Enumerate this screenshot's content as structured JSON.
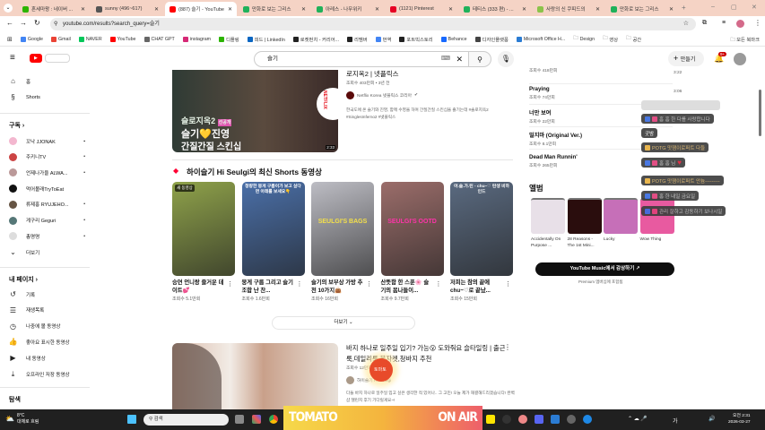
{
  "browser": {
    "tabs": [
      {
        "label": "혼세마왕 : 네이버 ...",
        "color": "#2db400"
      },
      {
        "label": "sunny (496~617)",
        "color": "#555"
      },
      {
        "label": "(887) 슬기 - YouTube",
        "color": "#ff0000",
        "active": true
      },
      {
        "label": "만화로 보는 그리스",
        "color": "#20b15a"
      },
      {
        "label": "아레스 - 나무위키",
        "color": "#20b15a"
      },
      {
        "label": "(1121) Pinterest",
        "color": "#e60023"
      },
      {
        "label": "테티스 (333 편) - ...",
        "color": "#20b15a"
      },
      {
        "label": "사랑의 신 쿠피드의",
        "color": "#8bc34a"
      },
      {
        "label": "만화로 보는 그리스",
        "color": "#20b15a"
      }
    ],
    "new_tab": "+",
    "window_controls": [
      "–",
      "▢",
      "✕"
    ],
    "url": "youtube.com/results?search_query=슬기",
    "bookmarks": [
      {
        "label": "Google",
        "color": "#4285f4"
      },
      {
        "label": "Gmail",
        "color": "#ea4335"
      },
      {
        "label": "NAVER",
        "color": "#03c75a"
      },
      {
        "label": "YouTube",
        "color": "#ff0000"
      },
      {
        "label": "CHAT GPT",
        "color": "#666"
      },
      {
        "label": "instagram",
        "color": "#d62976"
      },
      {
        "label": "디플링",
        "color": "#2db400"
      },
      {
        "label": "피드 | LinkedIn",
        "color": "#0a66c2"
      },
      {
        "label": "로켓펀치 - 커리어...",
        "color": "#222"
      },
      {
        "label": "리멤버",
        "color": "#222"
      },
      {
        "label": "번역",
        "color": "#4285f4"
      },
      {
        "label": "포트빅스토리",
        "color": "#222"
      },
      {
        "label": "Behance",
        "color": "#1769ff"
      },
      {
        "label": "디자인플랫폼",
        "color": "#444"
      },
      {
        "label": "Microsoft Office H...",
        "color": "#2b7cd3"
      },
      {
        "label": "Design",
        "color": "#fff"
      },
      {
        "label": "영상",
        "color": "#fff"
      },
      {
        "label": "공간",
        "color": "#fff"
      }
    ],
    "all_bookmarks": "모든 북마크"
  },
  "youtube": {
    "search_value": "슬기",
    "create_label": "만들기",
    "notif_count": "9+",
    "sidebar": {
      "top": [
        {
          "label": "홈",
          "icon": "home-icon"
        },
        {
          "label": "Shorts",
          "icon": "shorts-icon"
        }
      ],
      "subs_title": "구독",
      "subs": [
        {
          "label": "꼬낙 JJONAK",
          "color": "#f3b7cf"
        },
        {
          "label": "주키니TV",
          "color": "#c44"
        },
        {
          "label": "언제나가을 ALWA...",
          "color": "#b99"
        },
        {
          "label": "먹어볼래TryToEat",
          "color": "#111"
        },
        {
          "label": "류제홍 RYUJEHO...",
          "color": "#654"
        },
        {
          "label": "게구리 Geguri",
          "color": "#577"
        },
        {
          "label": "총명명",
          "color": "#ddd"
        }
      ],
      "more": "더보기",
      "mypage_title": "내 페이지",
      "mypage": [
        {
          "label": "기록",
          "icon": "history-icon",
          "g": "↺"
        },
        {
          "label": "재생목록",
          "icon": "playlist-icon",
          "g": "☰"
        },
        {
          "label": "나중에 볼 동영상",
          "icon": "clock-icon",
          "g": "◷"
        },
        {
          "label": "좋아요 표시한 동영상",
          "icon": "thumbs-up-icon",
          "g": "👍"
        },
        {
          "label": "내 동영상",
          "icon": "my-videos-icon",
          "g": "▶"
        },
        {
          "label": "오프라인 저장 동영상",
          "icon": "download-icon",
          "g": "⤓"
        }
      ],
      "explore_title": "탐색"
    },
    "video1": {
      "title": "로지옥2 | 넷플릭스",
      "meta": "조회수 403만회 • 3년 전",
      "channel": "Netflix Korea 넷플릭스 코리아",
      "desc": "한국도에 온 슬기와 진영, 함께 수영을 하며 간질간질 스킨십을 즐기는데 #솔로지옥2 #SinglesInferno2 #넷플릭스",
      "duration": "2:33",
      "thumb_line1": "슬로지옥2",
      "thumb_tag": "선공개",
      "thumb_line2": "슬기💛진영",
      "thumb_line3": "간질간질 스킨십",
      "brand": "NETFLIX"
    },
    "shorts_title": "하이슬기 Hi Seulgi의 최신 Shorts 동영상",
    "shorts": [
      {
        "title": "승연 언니랑 즐거운 데이트💕",
        "views": "조회수 5.1만회",
        "badge": "새 동영상",
        "bg": "#8fa24a"
      },
      {
        "title": "뭉게 구름 그리고 슬기 조합 난 찬...",
        "views": "조회수 1.6만회",
        "overlay": "청량한 뭉게 구름이가 보고 싶다면 아래를 보세요👇",
        "bg": "#4a6fa8"
      },
      {
        "title": "슬기의 보부상 가방 추천 10가지👜",
        "views": "조회수 16만회",
        "overlay": "SEULGI'S BAGS",
        "bg": "#bdbdc4"
      },
      {
        "title": "산뜻함 한 스푼🌸 슬기의 봄나들이...",
        "views": "조회수 9.7만회",
        "overlay": "SEULGI'S OOTD",
        "bg": "#9b6d6a"
      },
      {
        "title": "저희는 참의 끝에 chu~♡로 끝났...",
        "views": "조회수 15만회",
        "overlay": "아.슬.가.린 - chu~♡ 탄생 비하인드",
        "bg": "#5a6a80"
      }
    ],
    "more_button": "더보기",
    "video2": {
      "title": "바지 하나로 일주일 입기? 가능😮 도와줘요 슬타일링 | 출근룩,데일리룩,봄자켓,청바지 추천",
      "meta": "조회수 12만회",
      "channel": "하이슬기 Hi Seulgi",
      "desc": "다들 바지 하나로 일주일 입고 싶은 생각한 적 있어나.. 그 고민! 오늘 제가 해결해드리겠습니다! 완벽샵 챌린지 후기 기다릴게요~!"
    },
    "right": {
      "songs": [
        {
          "name": "",
          "views": "조회수 418만회",
          "time": "3:22"
        },
        {
          "name": "Praying",
          "views": "조회수 74만회",
          "time": "3:06"
        },
        {
          "name": "너만 보여",
          "views": "조회수 22만회"
        },
        {
          "name": "밀지마 (Original Ver.)",
          "views": "조회수 8.1만회"
        },
        {
          "name": "Dead Man Runnin'",
          "views": "조회수 265만회"
        }
      ],
      "albums_title": "앨범",
      "albums": [
        {
          "name": "Accidentally On Purpose ...",
          "bg": "#e8e0e8"
        },
        {
          "name": "28 Reasons - The 1st Mini...",
          "bg": "#2a0d0d"
        },
        {
          "name": "Lucky",
          "bg": "#c66fb8"
        },
        {
          "name": "Wow Thing",
          "bg": "#e85aa0"
        }
      ],
      "music_button": "YouTube Music에서 감상하기",
      "premium_note": "Premium 멤버십에 포함됨"
    }
  },
  "chat_overlay": [
    "흠 흠 한 다를 사랑합니다",
    "굿밤",
    "POTG 맛잼이로퍼트 다들",
    "홈 홈 님",
    "POTG 맛잼이로퍼트 안늄---------",
    "홈 한 내일 금요일",
    "관리 잘하고 감동하기 보나시일"
  ],
  "stream_overlay": {
    "left": "TOMATO",
    "right": "ON AIR",
    "logo": "토마토"
  },
  "taskbar": {
    "weather_temp": "8°C",
    "weather_desc": "대체로 흐림",
    "search_placeholder": "검색",
    "time": "오전 2:31",
    "date": "2026-03-27",
    "ime": "가"
  }
}
